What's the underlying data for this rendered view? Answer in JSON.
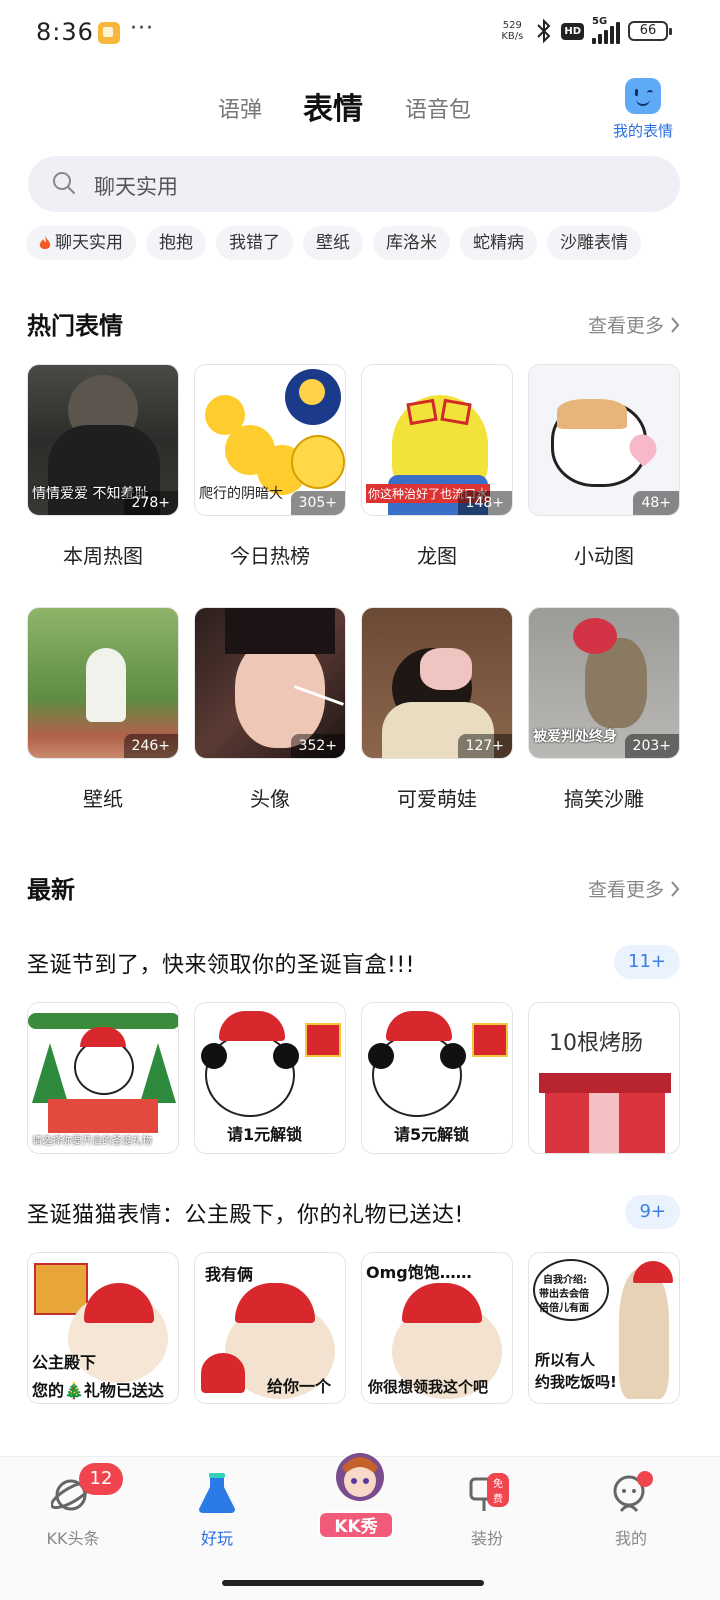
{
  "status_bar": {
    "time": "8:36",
    "dots": "···",
    "net_speed_value": "529",
    "net_speed_unit": "KB/s",
    "hd": "HD",
    "network": "5G",
    "battery": "66"
  },
  "top_tabs": {
    "items": [
      "语弹",
      "表情",
      "语音包"
    ],
    "active_index": 1,
    "my_stickers": "我的表情"
  },
  "search": {
    "placeholder": "聊天实用"
  },
  "chips": [
    "聊天实用",
    "抱抱",
    "我错了",
    "壁纸",
    "库洛米",
    "蛇精病",
    "沙雕表情"
  ],
  "hot": {
    "title": "热门表情",
    "see_more": "查看更多",
    "items": [
      {
        "label": "本周热图",
        "count": "278+",
        "caption": "情情爱爱 不知羞耻"
      },
      {
        "label": "今日热榜",
        "count": "305+",
        "caption": "爬行的阴暗大"
      },
      {
        "label": "龙图",
        "count": "148+",
        "caption": "你这种治好了也流口水"
      },
      {
        "label": "小动图",
        "count": "48+",
        "caption": ""
      },
      {
        "label": "壁纸",
        "count": "246+",
        "caption": ""
      },
      {
        "label": "头像",
        "count": "352+",
        "caption": ""
      },
      {
        "label": "可爱萌娃",
        "count": "127+",
        "caption": ""
      },
      {
        "label": "搞笑沙雕",
        "count": "203+",
        "caption": "被爱判处终身"
      }
    ]
  },
  "latest": {
    "title": "最新",
    "see_more": "查看更多",
    "albums": [
      {
        "title": "圣诞节到了，快来领取你的圣诞盲盒!!!",
        "count": "11+",
        "stickers": [
          "请选择你要开启的圣诞礼物",
          "请1元解锁",
          "请5元解锁",
          "10根烤肠"
        ]
      },
      {
        "title": "圣诞猫猫表情：公主殿下，你的礼物已送达!",
        "count": "9+",
        "stickers": [
          {
            "top": "",
            "bottom": "公主殿下",
            "bottom2": "您的🎄礼物已送达"
          },
          {
            "top": "我有俩",
            "bottom": "给你一个",
            "bottom2": ""
          },
          {
            "top": "Omg饱饱……",
            "bottom": "你很想领我这个吧",
            "bottom2": ""
          },
          {
            "top": "自我介绍:",
            "top2": "带出去会倍",
            "top3": "倍倍儿有面",
            "bottom": "所以有人",
            "bottom2": "约我吃饭吗!"
          }
        ]
      }
    ]
  },
  "bottom_nav": {
    "items": [
      {
        "label": "KK头条",
        "badge": "12"
      },
      {
        "label": "好玩",
        "badge": ""
      },
      {
        "label": "KK秀",
        "badge": ""
      },
      {
        "label": "装扮",
        "badge": "免费"
      },
      {
        "label": "我的",
        "badge": ""
      }
    ],
    "active_index": 1
  },
  "colors": {
    "accent_blue": "#2a6fe0",
    "badge_red": "#f0454f",
    "tab_underline": "#ffd400"
  }
}
